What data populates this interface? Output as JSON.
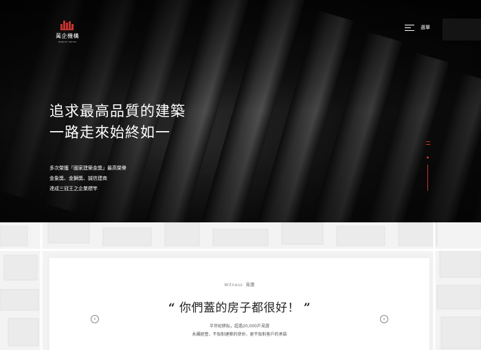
{
  "brand": {
    "name": "萬企機構",
    "tagline": "WANCHI GROUP"
  },
  "nav": {
    "menu_label": "選單"
  },
  "hero": {
    "headline": [
      "追求最高品質的建築",
      "一路走來始終如一"
    ],
    "intro": [
      "多次榮獲「國家建築金獎」最高榮譽",
      "金象獎、金獅獎、誠信建商",
      "達成三冠王之企業標竿"
    ]
  },
  "witness": {
    "label_en": "Witness",
    "label_zh": "見證",
    "quote": "你們蓋的房子都很好！",
    "open_mark": "“",
    "close_mark": "”",
    "desc": [
      "半世紀耕耘，超過20,000戶見證",
      "永續經營，不負對建築的使命，更不負對客戶的承諾"
    ],
    "prev_glyph": "‹",
    "next_glyph": "›"
  },
  "colors": {
    "accent": "#c8322d",
    "hero_bg": "#0a0a0a",
    "text_light": "#ffffff"
  },
  "icons": {
    "menu": "hamburger-menu-icon",
    "prev": "chevron-left-icon",
    "next": "chevron-right-icon",
    "logo": "building-logo-icon"
  }
}
